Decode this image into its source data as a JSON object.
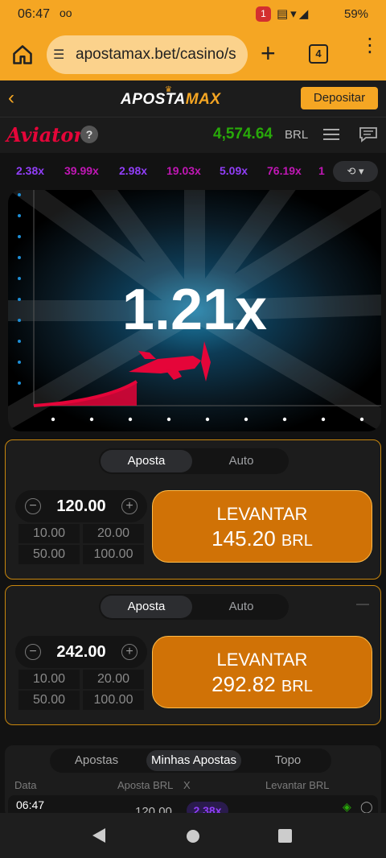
{
  "status": {
    "time": "06:47",
    "voicemail": "oo",
    "notification_count": "1",
    "battery": "59%"
  },
  "browser": {
    "url": "apostamax.bet/casino/s",
    "tab_count": "4"
  },
  "site": {
    "logo_part1": "APOSTA",
    "logo_part2": "MAX",
    "deposit_label": "Depositar"
  },
  "aviator": {
    "logo": "Aviator",
    "help": "?",
    "balance": "4,574.64",
    "currency": "BRL"
  },
  "history": {
    "multipliers": [
      {
        "value": "2.38x",
        "color": "#913ef8"
      },
      {
        "value": "39.99x",
        "color": "#c017b4"
      },
      {
        "value": "2.98x",
        "color": "#913ef8"
      },
      {
        "value": "19.03x",
        "color": "#c017b4"
      },
      {
        "value": "5.09x",
        "color": "#913ef8"
      },
      {
        "value": "76.19x",
        "color": "#c017b4"
      },
      {
        "value": "1",
        "color": "#c017b4"
      }
    ]
  },
  "game": {
    "multiplier": "1.21x"
  },
  "bet1": {
    "tab_active": "Aposta",
    "tab_inactive": "Auto",
    "stake": "120.00",
    "quick": [
      "10.00",
      "20.00",
      "50.00",
      "100.00"
    ],
    "cashout_label": "LEVANTAR",
    "cashout_amount": "145.20",
    "cashout_currency": "BRL"
  },
  "bet2": {
    "tab_active": "Aposta",
    "tab_inactive": "Auto",
    "stake": "242.00",
    "quick": [
      "10.00",
      "20.00",
      "50.00",
      "100.00"
    ],
    "cashout_label": "LEVANTAR",
    "cashout_amount": "292.82",
    "cashout_currency": "BRL"
  },
  "bets_table": {
    "tabs": [
      "Apostas",
      "Minhas Apostas",
      "Topo"
    ],
    "columns": [
      "Data",
      "Aposta BRL",
      "X",
      "Levantar BRL"
    ],
    "rows": [
      {
        "time": "06:47",
        "bet": "120.00",
        "x": "2.38x"
      }
    ]
  },
  "colors": {
    "accent": "#f5a623",
    "aviator_red": "#e50539",
    "balance_green": "#28a909",
    "cashout": "#d07206"
  }
}
